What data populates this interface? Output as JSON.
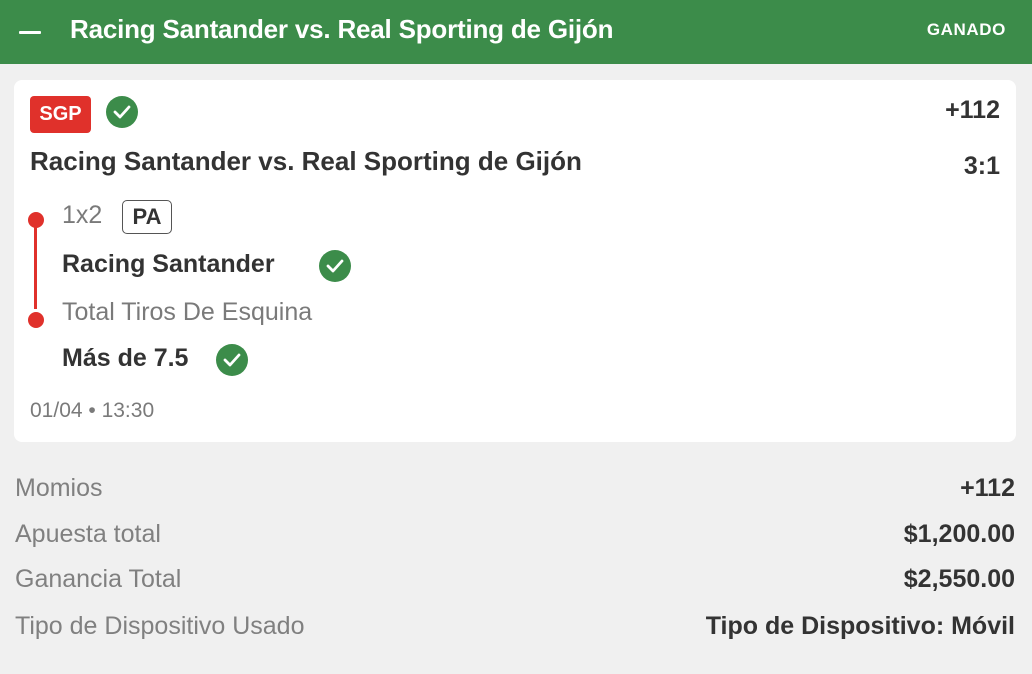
{
  "header": {
    "title": "Racing Santander vs. Real Sporting de Gijón",
    "status": "GANADO",
    "color": "#3c8c4a"
  },
  "card": {
    "badge": "SGP",
    "badge_color": "#e0312b",
    "odds": "+112",
    "match_title": "Racing Santander vs. Real Sporting de Gijón",
    "score": "3:1",
    "legs": [
      {
        "market": "1x2",
        "tag": "PA",
        "selection": "Racing Santander",
        "status_icon": "check-circle-icon"
      },
      {
        "market": "Total Tiros De Esquina",
        "selection": "Más de 7.5",
        "status_icon": "check-circle-icon"
      }
    ],
    "datetime": "01/04 • 13:30"
  },
  "summary": [
    {
      "label": "Momios",
      "value": "+112"
    },
    {
      "label": "Apuesta total",
      "value": "$1,200.00"
    },
    {
      "label": "Ganancia Total",
      "value": "$2,550.00"
    },
    {
      "label": "Tipo de Dispositivo Usado",
      "value": "Tipo de Dispositivo: Móvil"
    }
  ]
}
